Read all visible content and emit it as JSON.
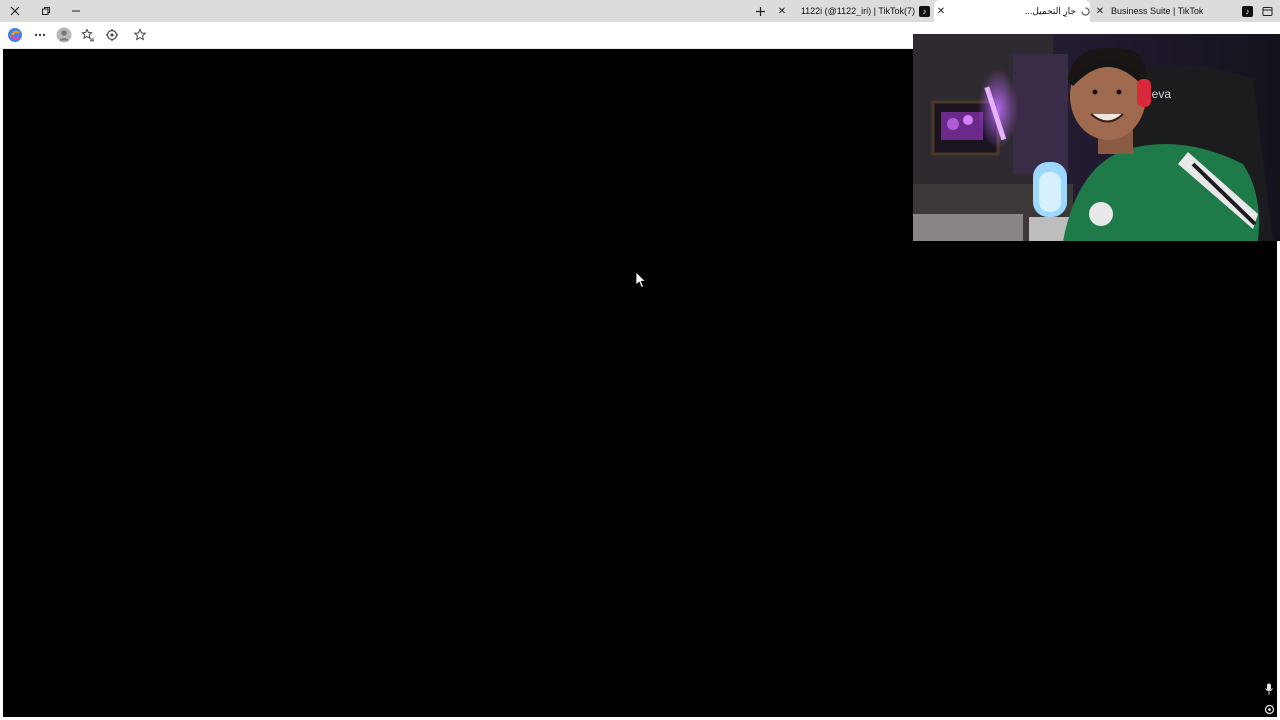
{
  "window": {
    "controls": {
      "close_glyph": "✕",
      "restore_glyph": "❐",
      "minimize_glyph": "—"
    }
  },
  "tabs": {
    "new_tab_glyph": "+",
    "items": [
      {
        "title": "1122i (@1122_iri) | TikTok(7)",
        "favicon": "tiktok-icon",
        "close_glyph": "✕",
        "active": false
      },
      {
        "title": "جارٍ التحميل...",
        "favicon": "loading-icon",
        "close_glyph": "✕",
        "active": true
      },
      {
        "title": "Business Suite | TikTok",
        "favicon": "tiktok-icon",
        "close_glyph": "✕",
        "active": false
      }
    ]
  },
  "toolbar": {
    "buttons": [
      "copilot-icon",
      "more-icon",
      "profile-icon",
      "collections-icon",
      "extensions-icon",
      "favorite-star-icon"
    ]
  },
  "overlay": {
    "webcam": "webcam-overlay"
  },
  "colors": {
    "tabstrip_bg": "#dcdcdc",
    "content_bg": "#000000",
    "webcam_shirt": "#1f7a4a",
    "neon_light": "#9b4dff"
  }
}
